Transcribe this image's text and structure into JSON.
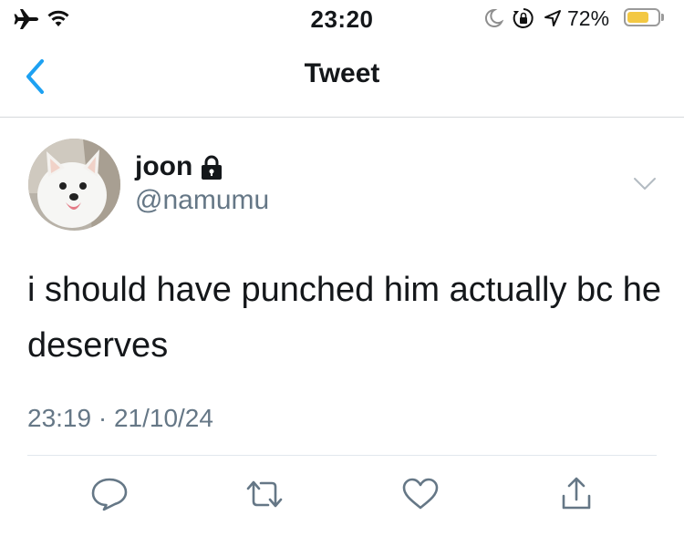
{
  "status_bar": {
    "time": "23:20",
    "battery_percent": "72%",
    "battery_level": 0.72,
    "icons": [
      "airplane-icon",
      "wifi-icon",
      "moon-icon",
      "rotation-lock-icon",
      "location-icon",
      "battery-icon"
    ]
  },
  "nav": {
    "title": "Tweet",
    "back_icon": "chevron-left-icon"
  },
  "tweet": {
    "display_name": "joon",
    "handle": "@namumu",
    "text": "i should have punched him actually bc he deserves",
    "timestamp": "23:19 · 21/10/24",
    "protected_icon": "lock-icon",
    "menu_icon": "chevron-down-icon"
  },
  "actions": [
    {
      "name": "reply",
      "icon": "comment-icon"
    },
    {
      "name": "retweet",
      "icon": "retweet-icon"
    },
    {
      "name": "like",
      "icon": "heart-icon"
    },
    {
      "name": "share",
      "icon": "share-icon"
    }
  ],
  "colors": {
    "accent": "#1da1f2",
    "secondary_text": "#657786",
    "battery_fill": "#f3c843"
  }
}
